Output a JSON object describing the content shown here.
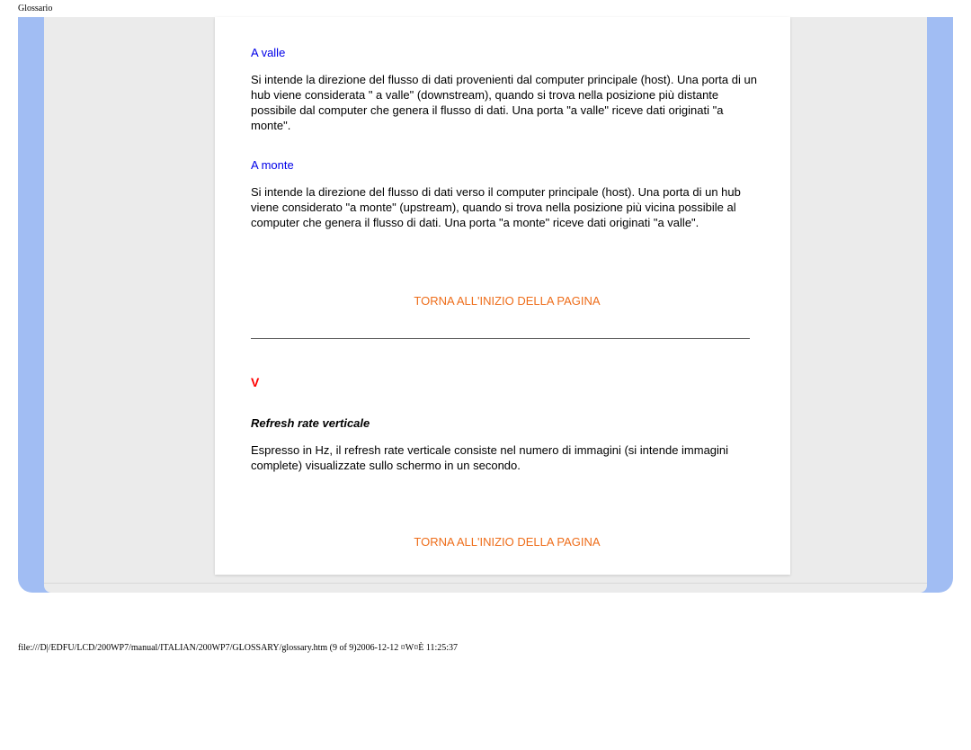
{
  "page_title": "Glossario",
  "terms": {
    "a_valle": {
      "title": "A valle",
      "body": "Si intende la direzione del flusso di dati provenienti dal computer principale (host). Una porta di un hub viene considerata \" a valle\" (downstream), quando si trova nella posizione più distante possibile dal computer che genera il flusso di dati. Una porta \"a valle\" riceve dati originati \"a monte\"."
    },
    "a_monte": {
      "title": "A monte",
      "body": "Si intende la direzione del flusso di dati verso il computer principale (host). Una porta di un hub viene considerato \"a monte\" (upstream), quando si trova nella posizione più vicina possibile al computer che genera il flusso di dati. Una porta \"a monte\" riceve dati originati \"a valle\"."
    }
  },
  "back_to_top": "TORNA ALL'INIZIO DELLA PAGINA",
  "section_v": {
    "letter": "V",
    "subhead": "Refresh rate verticale",
    "body": "Espresso in Hz, il refresh rate verticale consiste nel numero di immagini (si intende immagini complete) visualizzate sullo schermo in un secondo."
  },
  "footer": "file:///D|/EDFU/LCD/200WP7/manual/ITALIAN/200WP7/GLOSSARY/glossary.htm (9 of 9)2006-12-12 ¤W¤È 11:25:37"
}
